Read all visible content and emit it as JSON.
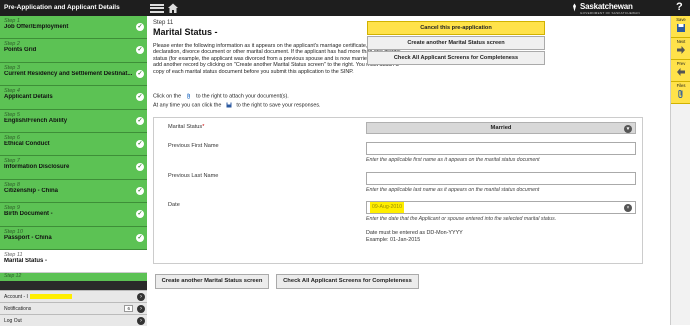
{
  "header": {
    "title": "Pre-Application and Applicant Details",
    "brand": "Saskatchewan",
    "brand_sub": "GOVERNMENT OF SASKATCHEWAN",
    "help": "?"
  },
  "sidebar": {
    "steps": [
      {
        "num": "Step 1",
        "label": "Job Offer/Employment"
      },
      {
        "num": "Step 2",
        "label": "Points Grid"
      },
      {
        "num": "Step 3",
        "label": "Current Residency and Settlement Destinat..."
      },
      {
        "num": "Step 4",
        "label": "Applicant Details"
      },
      {
        "num": "Step 5",
        "label": "English/French Ability"
      },
      {
        "num": "Step 6",
        "label": "Ethical Conduct"
      },
      {
        "num": "Step 7",
        "label": "Information Disclosure"
      },
      {
        "num": "Step 8",
        "label": "Citizenship - China"
      },
      {
        "num": "Step 9",
        "label": "Birth Document -"
      },
      {
        "num": "Step 10",
        "label": "Passport - China"
      }
    ],
    "current": {
      "num": "Step 11",
      "label": "Marital Status -"
    },
    "next": {
      "num": "Step 12"
    },
    "account_label": "Account - I",
    "notifications_label": "Notifications",
    "notifications_count": "6",
    "logout_label": "Log Out"
  },
  "main": {
    "step": "Step 11",
    "title": "Marital Status -",
    "intro": "Please enter the following information as it appears on the applicant's marriage certificate, common-law declaration, divorce document or other marital document. If the applicant has had more than one marital status (for example, the applicant was divorced from a previous spouse and is now married again), please add another record by clicking on \"Create another Marital Status screen\" to the right. You must attach a copy of each marital status document before you submit this application to the SINP.",
    "attach_prefix": "Click on the",
    "attach_suffix": "to the right to attach your document(s).",
    "save_prefix": "At any time you can click the",
    "save_suffix": "to the right to save your responses.",
    "actions": {
      "cancel": "Cancel this pre-application",
      "create_another": "Create another Marital Status screen",
      "check_all": "Check All Applicant Screens for Completeness"
    },
    "form": {
      "marital_status_label": "Marital Status",
      "required_mark": "*",
      "marital_status_value": "Married",
      "first_name_label": "Previous First Name",
      "first_name_value": "",
      "first_name_hint": "Enter the applicable first name as it appears on the marital status document",
      "last_name_label": "Previous Last Name",
      "last_name_value": "",
      "last_name_hint": "Enter the applicable last name as it appears on the marital status document",
      "date_label": "Date",
      "date_value": "09-Aug-2010",
      "date_hint": "Enter the date that the Applicant or spouse entered into the selected marital status.",
      "date_note1": "Date must be entered as DD-Mon-YYYY",
      "date_note2": "Example: 01-Jan-2015"
    },
    "bottom": {
      "create_another": "Create another Marital Status screen",
      "check_all": "Check All Applicant Screens for Completeness"
    }
  },
  "toolbar": {
    "save": "Save",
    "next": "Next",
    "prev": "Prev",
    "files": "Files"
  },
  "colors": {
    "step_green": "#5cc254",
    "accent_yellow": "#ffe24a",
    "topbar": "#1e1e1e"
  }
}
